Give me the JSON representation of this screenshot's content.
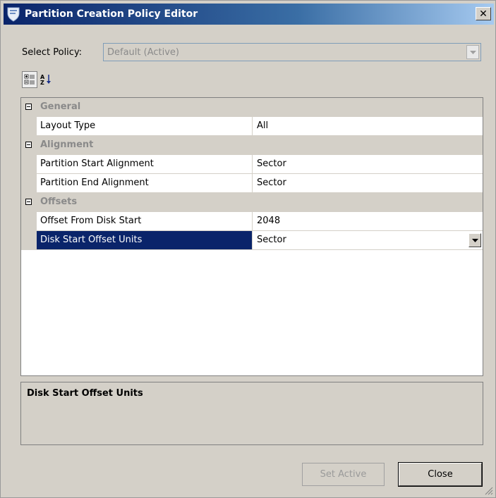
{
  "window": {
    "title": "Partition Creation Policy Editor",
    "close_glyph": "✕"
  },
  "policy": {
    "label": "Select Policy:",
    "value": "Default (Active)"
  },
  "toolbar": {
    "categorized_icon": "categorized-view-icon",
    "alphabetical_icon": "sort-alphabetical-icon"
  },
  "grid": {
    "categories": [
      {
        "name": "General",
        "properties": [
          {
            "name": "Layout Type",
            "value": "All"
          }
        ]
      },
      {
        "name": "Alignment",
        "properties": [
          {
            "name": "Partition Start Alignment",
            "value": "Sector"
          },
          {
            "name": "Partition End Alignment",
            "value": "Sector"
          }
        ]
      },
      {
        "name": "Offsets",
        "properties": [
          {
            "name": "Offset From Disk Start",
            "value": "2048"
          },
          {
            "name": "Disk Start Offset Units",
            "value": "Sector"
          }
        ]
      }
    ],
    "selected_property": "Disk Start Offset Units"
  },
  "description": {
    "title": "Disk Start Offset Units"
  },
  "buttons": {
    "set_active": "Set Active",
    "close": "Close"
  },
  "colors": {
    "selection": "#0a246a",
    "titlebar_start": "#0a246a",
    "face": "#d4d0c8"
  }
}
